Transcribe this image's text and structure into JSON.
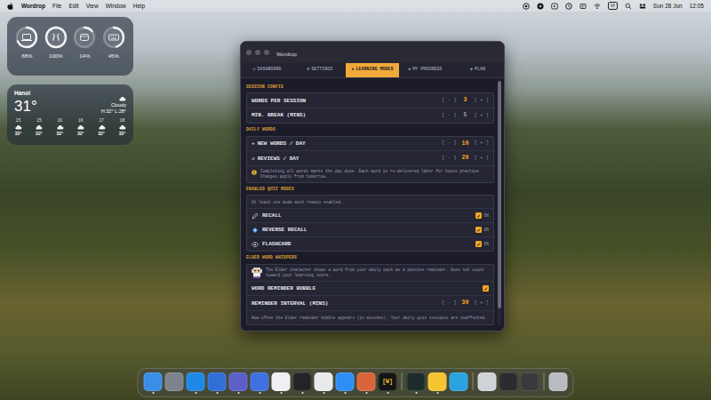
{
  "menubar": {
    "app": "Wordrop",
    "menus": [
      "File",
      "Edit",
      "View",
      "Window",
      "Help"
    ],
    "input_source": "VI",
    "date": "Sun 28 Jun",
    "time": "12:05"
  },
  "battery_widget": {
    "devices": [
      {
        "reading": "68%",
        "level": 0.68
      },
      {
        "reading": "100%",
        "level": 1
      },
      {
        "reading": "14%",
        "level": 0.14
      },
      {
        "reading": "45%",
        "level": 0.45
      }
    ]
  },
  "weather_widget": {
    "city": "Hanoi",
    "temperature": "31°",
    "condition": "Cloudy",
    "high_low": "H:32° L:28°",
    "hours": [
      {
        "hour": "15",
        "temp": "32°"
      },
      {
        "hour": "15",
        "temp": "32°"
      },
      {
        "hour": "16",
        "temp": "32°"
      },
      {
        "hour": "16",
        "temp": "32°"
      },
      {
        "hour": "17",
        "temp": "32°"
      },
      {
        "hour": "18",
        "temp": "32°"
      }
    ]
  },
  "window": {
    "title": "Wordrop"
  },
  "tabs": [
    {
      "icon": "◇",
      "label": "DASHBOARD",
      "selected": false
    },
    {
      "icon": "⚙",
      "label": "SETTINGS",
      "selected": false
    },
    {
      "icon": "◈",
      "label": "LEARNING MODES",
      "selected": true
    },
    {
      "icon": "◈",
      "label": "MY PROGRESS",
      "selected": false
    },
    {
      "icon": "◈",
      "label": "PLAN",
      "selected": false
    }
  ],
  "scroll": {
    "level": 0.93
  },
  "sections": [
    {
      "title": "SESSION CONFIG",
      "rows": [
        {
          "kind": "stepper",
          "label": "WORDS PER SESSION",
          "minus": "[ - ]",
          "value": "3",
          "plus": "[ + ]",
          "accent": true
        },
        {
          "kind": "stepper",
          "label": "MIN. BREAK (MINS)",
          "minus": "[ - ]",
          "value": "5",
          "plus": "[ + ]",
          "accent": false
        }
      ]
    },
    {
      "title": "DAILY WORDS",
      "rows": [
        {
          "kind": "stepper",
          "icon": "★",
          "label": "NEW WORDS / DAY",
          "minus": "[ - ]",
          "value": "10",
          "plus": "[ + ]",
          "accent": true
        },
        {
          "kind": "stepper",
          "icon": "↺",
          "label": "REVIEWS / DAY",
          "minus": "[ - ]",
          "value": "20",
          "plus": "[ + ]",
          "accent": true
        },
        {
          "kind": "note",
          "text": "Completing all words marks the day done. Each word is re-delivered later for bonus practice. Changes apply from tomorrow."
        }
      ]
    },
    {
      "title": "ENABLED QUIZ MODES",
      "rows": [
        {
          "kind": "caption",
          "text": "At least one mode must remain enabled."
        },
        {
          "kind": "toggle",
          "label": "RECALL",
          "checked": true,
          "state": "ON"
        },
        {
          "kind": "toggle",
          "label": "REVERSE RECALL",
          "checked": true,
          "state": "ON"
        },
        {
          "kind": "toggle",
          "label": "FLASHCARD",
          "checked": true,
          "state": "ON"
        }
      ]
    },
    {
      "title": "ELDER WORD WHISPERS",
      "rows": [
        {
          "kind": "elder",
          "text": "The Elder character shows a word from your daily pack as a passive reminder. Does not count toward your learning score."
        },
        {
          "kind": "checkbox",
          "label": "WORD REMINDER BUBBLE",
          "checked": true
        },
        {
          "kind": "stepper",
          "label": "REMINDER INTERVAL (MINS)",
          "minus": "[ - ]",
          "value": "30",
          "plus": "[ + ]",
          "accent": true
        },
        {
          "kind": "caption",
          "text": "How often the Elder reminder bubble appears (in minutes). Your daily quiz sessions are unaffected."
        }
      ]
    }
  ],
  "dock": {
    "items": [
      {
        "kind": "app",
        "color": "#3a8ee6",
        "running": true
      },
      {
        "kind": "app",
        "color": "#7d838c",
        "running": false
      },
      {
        "kind": "app",
        "color": "#1e88e5",
        "running": true
      },
      {
        "kind": "app",
        "color": "#2f6fd6",
        "running": true
      },
      {
        "kind": "app",
        "color": "#5b5fc7",
        "running": true
      },
      {
        "kind": "app",
        "color": "#3f6fe0",
        "running": true
      },
      {
        "kind": "app",
        "color": "#eef0f3",
        "running": true
      },
      {
        "kind": "app",
        "color": "#222428",
        "running": true
      },
      {
        "kind": "app",
        "color": "#e9eaec",
        "running": true
      },
      {
        "kind": "app",
        "color": "#2f8ef5",
        "running": true
      },
      {
        "kind": "app",
        "color": "#d9663b",
        "running": true
      },
      {
        "kind": "app",
        "color": "#141414",
        "running": true,
        "glyph": "[W]"
      },
      {
        "kind": "separator"
      },
      {
        "kind": "app",
        "color": "#1e2b2b",
        "running": true
      },
      {
        "kind": "app",
        "color": "#f5c431",
        "running": true
      },
      {
        "kind": "app",
        "color": "#2aa3e0",
        "running": false
      },
      {
        "kind": "separator"
      },
      {
        "kind": "app",
        "color": "#cfd3d8",
        "running": false
      },
      {
        "kind": "app",
        "color": "#2c2c2e",
        "running": false
      },
      {
        "kind": "app",
        "color": "#3a3a3c",
        "running": false
      },
      {
        "kind": "separator"
      },
      {
        "kind": "app",
        "color": "#b9bcc0",
        "running": false
      }
    ]
  }
}
